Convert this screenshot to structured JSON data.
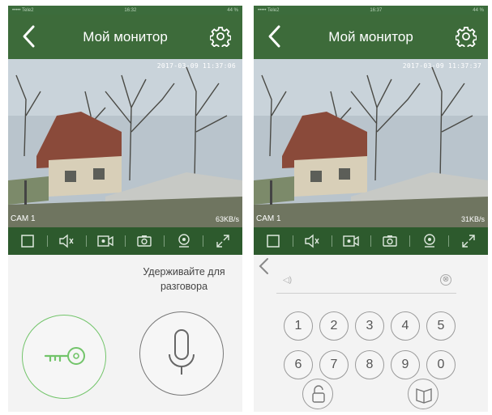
{
  "screens": [
    {
      "status": {
        "carrier": "••••• Tele2",
        "time": "16:32",
        "battery": "44 %"
      },
      "header": {
        "title": "Мой монитор"
      },
      "video": {
        "timestamp": "2017-03-09 11:37:06",
        "camera": "CAM 1",
        "bitrate": "63KB/s"
      },
      "panel": {
        "hint": "Удерживайте для разговора"
      }
    },
    {
      "status": {
        "carrier": "••••• Tele2",
        "time": "16:37",
        "battery": "44 %"
      },
      "header": {
        "title": "Мой монитор"
      },
      "video": {
        "timestamp": "2017-03-09 11:37:37",
        "camera": "CAM 1",
        "bitrate": "31KB/s"
      },
      "keypad": {
        "keys": [
          "1",
          "2",
          "3",
          "4",
          "5",
          "6",
          "7",
          "8",
          "9",
          "0"
        ],
        "clear_symbol": "⊗",
        "speaker_symbol": "◁)"
      }
    }
  ],
  "toolbar_icons": [
    "fullscreen-square-icon",
    "mute-icon",
    "record-icon",
    "snapshot-icon",
    "playback-icon",
    "expand-icon"
  ],
  "colors": {
    "header": "#3d6b3a",
    "toolbar": "#2d5a2d",
    "key_accent": "#72c46a"
  }
}
